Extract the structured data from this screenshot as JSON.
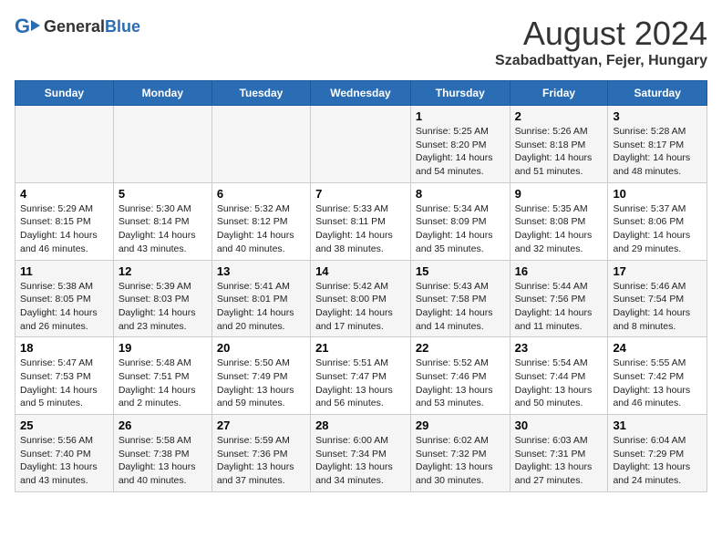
{
  "header": {
    "logo_general": "General",
    "logo_blue": "Blue",
    "title": "August 2024",
    "subtitle": "Szabadbattyan, Fejer, Hungary"
  },
  "weekdays": [
    "Sunday",
    "Monday",
    "Tuesday",
    "Wednesday",
    "Thursday",
    "Friday",
    "Saturday"
  ],
  "weeks": [
    [
      {
        "day": "",
        "info": ""
      },
      {
        "day": "",
        "info": ""
      },
      {
        "day": "",
        "info": ""
      },
      {
        "day": "",
        "info": ""
      },
      {
        "day": "1",
        "info": "Sunrise: 5:25 AM\nSunset: 8:20 PM\nDaylight: 14 hours\nand 54 minutes."
      },
      {
        "day": "2",
        "info": "Sunrise: 5:26 AM\nSunset: 8:18 PM\nDaylight: 14 hours\nand 51 minutes."
      },
      {
        "day": "3",
        "info": "Sunrise: 5:28 AM\nSunset: 8:17 PM\nDaylight: 14 hours\nand 48 minutes."
      }
    ],
    [
      {
        "day": "4",
        "info": "Sunrise: 5:29 AM\nSunset: 8:15 PM\nDaylight: 14 hours\nand 46 minutes."
      },
      {
        "day": "5",
        "info": "Sunrise: 5:30 AM\nSunset: 8:14 PM\nDaylight: 14 hours\nand 43 minutes."
      },
      {
        "day": "6",
        "info": "Sunrise: 5:32 AM\nSunset: 8:12 PM\nDaylight: 14 hours\nand 40 minutes."
      },
      {
        "day": "7",
        "info": "Sunrise: 5:33 AM\nSunset: 8:11 PM\nDaylight: 14 hours\nand 38 minutes."
      },
      {
        "day": "8",
        "info": "Sunrise: 5:34 AM\nSunset: 8:09 PM\nDaylight: 14 hours\nand 35 minutes."
      },
      {
        "day": "9",
        "info": "Sunrise: 5:35 AM\nSunset: 8:08 PM\nDaylight: 14 hours\nand 32 minutes."
      },
      {
        "day": "10",
        "info": "Sunrise: 5:37 AM\nSunset: 8:06 PM\nDaylight: 14 hours\nand 29 minutes."
      }
    ],
    [
      {
        "day": "11",
        "info": "Sunrise: 5:38 AM\nSunset: 8:05 PM\nDaylight: 14 hours\nand 26 minutes."
      },
      {
        "day": "12",
        "info": "Sunrise: 5:39 AM\nSunset: 8:03 PM\nDaylight: 14 hours\nand 23 minutes."
      },
      {
        "day": "13",
        "info": "Sunrise: 5:41 AM\nSunset: 8:01 PM\nDaylight: 14 hours\nand 20 minutes."
      },
      {
        "day": "14",
        "info": "Sunrise: 5:42 AM\nSunset: 8:00 PM\nDaylight: 14 hours\nand 17 minutes."
      },
      {
        "day": "15",
        "info": "Sunrise: 5:43 AM\nSunset: 7:58 PM\nDaylight: 14 hours\nand 14 minutes."
      },
      {
        "day": "16",
        "info": "Sunrise: 5:44 AM\nSunset: 7:56 PM\nDaylight: 14 hours\nand 11 minutes."
      },
      {
        "day": "17",
        "info": "Sunrise: 5:46 AM\nSunset: 7:54 PM\nDaylight: 14 hours\nand 8 minutes."
      }
    ],
    [
      {
        "day": "18",
        "info": "Sunrise: 5:47 AM\nSunset: 7:53 PM\nDaylight: 14 hours\nand 5 minutes."
      },
      {
        "day": "19",
        "info": "Sunrise: 5:48 AM\nSunset: 7:51 PM\nDaylight: 14 hours\nand 2 minutes."
      },
      {
        "day": "20",
        "info": "Sunrise: 5:50 AM\nSunset: 7:49 PM\nDaylight: 13 hours\nand 59 minutes."
      },
      {
        "day": "21",
        "info": "Sunrise: 5:51 AM\nSunset: 7:47 PM\nDaylight: 13 hours\nand 56 minutes."
      },
      {
        "day": "22",
        "info": "Sunrise: 5:52 AM\nSunset: 7:46 PM\nDaylight: 13 hours\nand 53 minutes."
      },
      {
        "day": "23",
        "info": "Sunrise: 5:54 AM\nSunset: 7:44 PM\nDaylight: 13 hours\nand 50 minutes."
      },
      {
        "day": "24",
        "info": "Sunrise: 5:55 AM\nSunset: 7:42 PM\nDaylight: 13 hours\nand 46 minutes."
      }
    ],
    [
      {
        "day": "25",
        "info": "Sunrise: 5:56 AM\nSunset: 7:40 PM\nDaylight: 13 hours\nand 43 minutes."
      },
      {
        "day": "26",
        "info": "Sunrise: 5:58 AM\nSunset: 7:38 PM\nDaylight: 13 hours\nand 40 minutes."
      },
      {
        "day": "27",
        "info": "Sunrise: 5:59 AM\nSunset: 7:36 PM\nDaylight: 13 hours\nand 37 minutes."
      },
      {
        "day": "28",
        "info": "Sunrise: 6:00 AM\nSunset: 7:34 PM\nDaylight: 13 hours\nand 34 minutes."
      },
      {
        "day": "29",
        "info": "Sunrise: 6:02 AM\nSunset: 7:32 PM\nDaylight: 13 hours\nand 30 minutes."
      },
      {
        "day": "30",
        "info": "Sunrise: 6:03 AM\nSunset: 7:31 PM\nDaylight: 13 hours\nand 27 minutes."
      },
      {
        "day": "31",
        "info": "Sunrise: 6:04 AM\nSunset: 7:29 PM\nDaylight: 13 hours\nand 24 minutes."
      }
    ]
  ]
}
